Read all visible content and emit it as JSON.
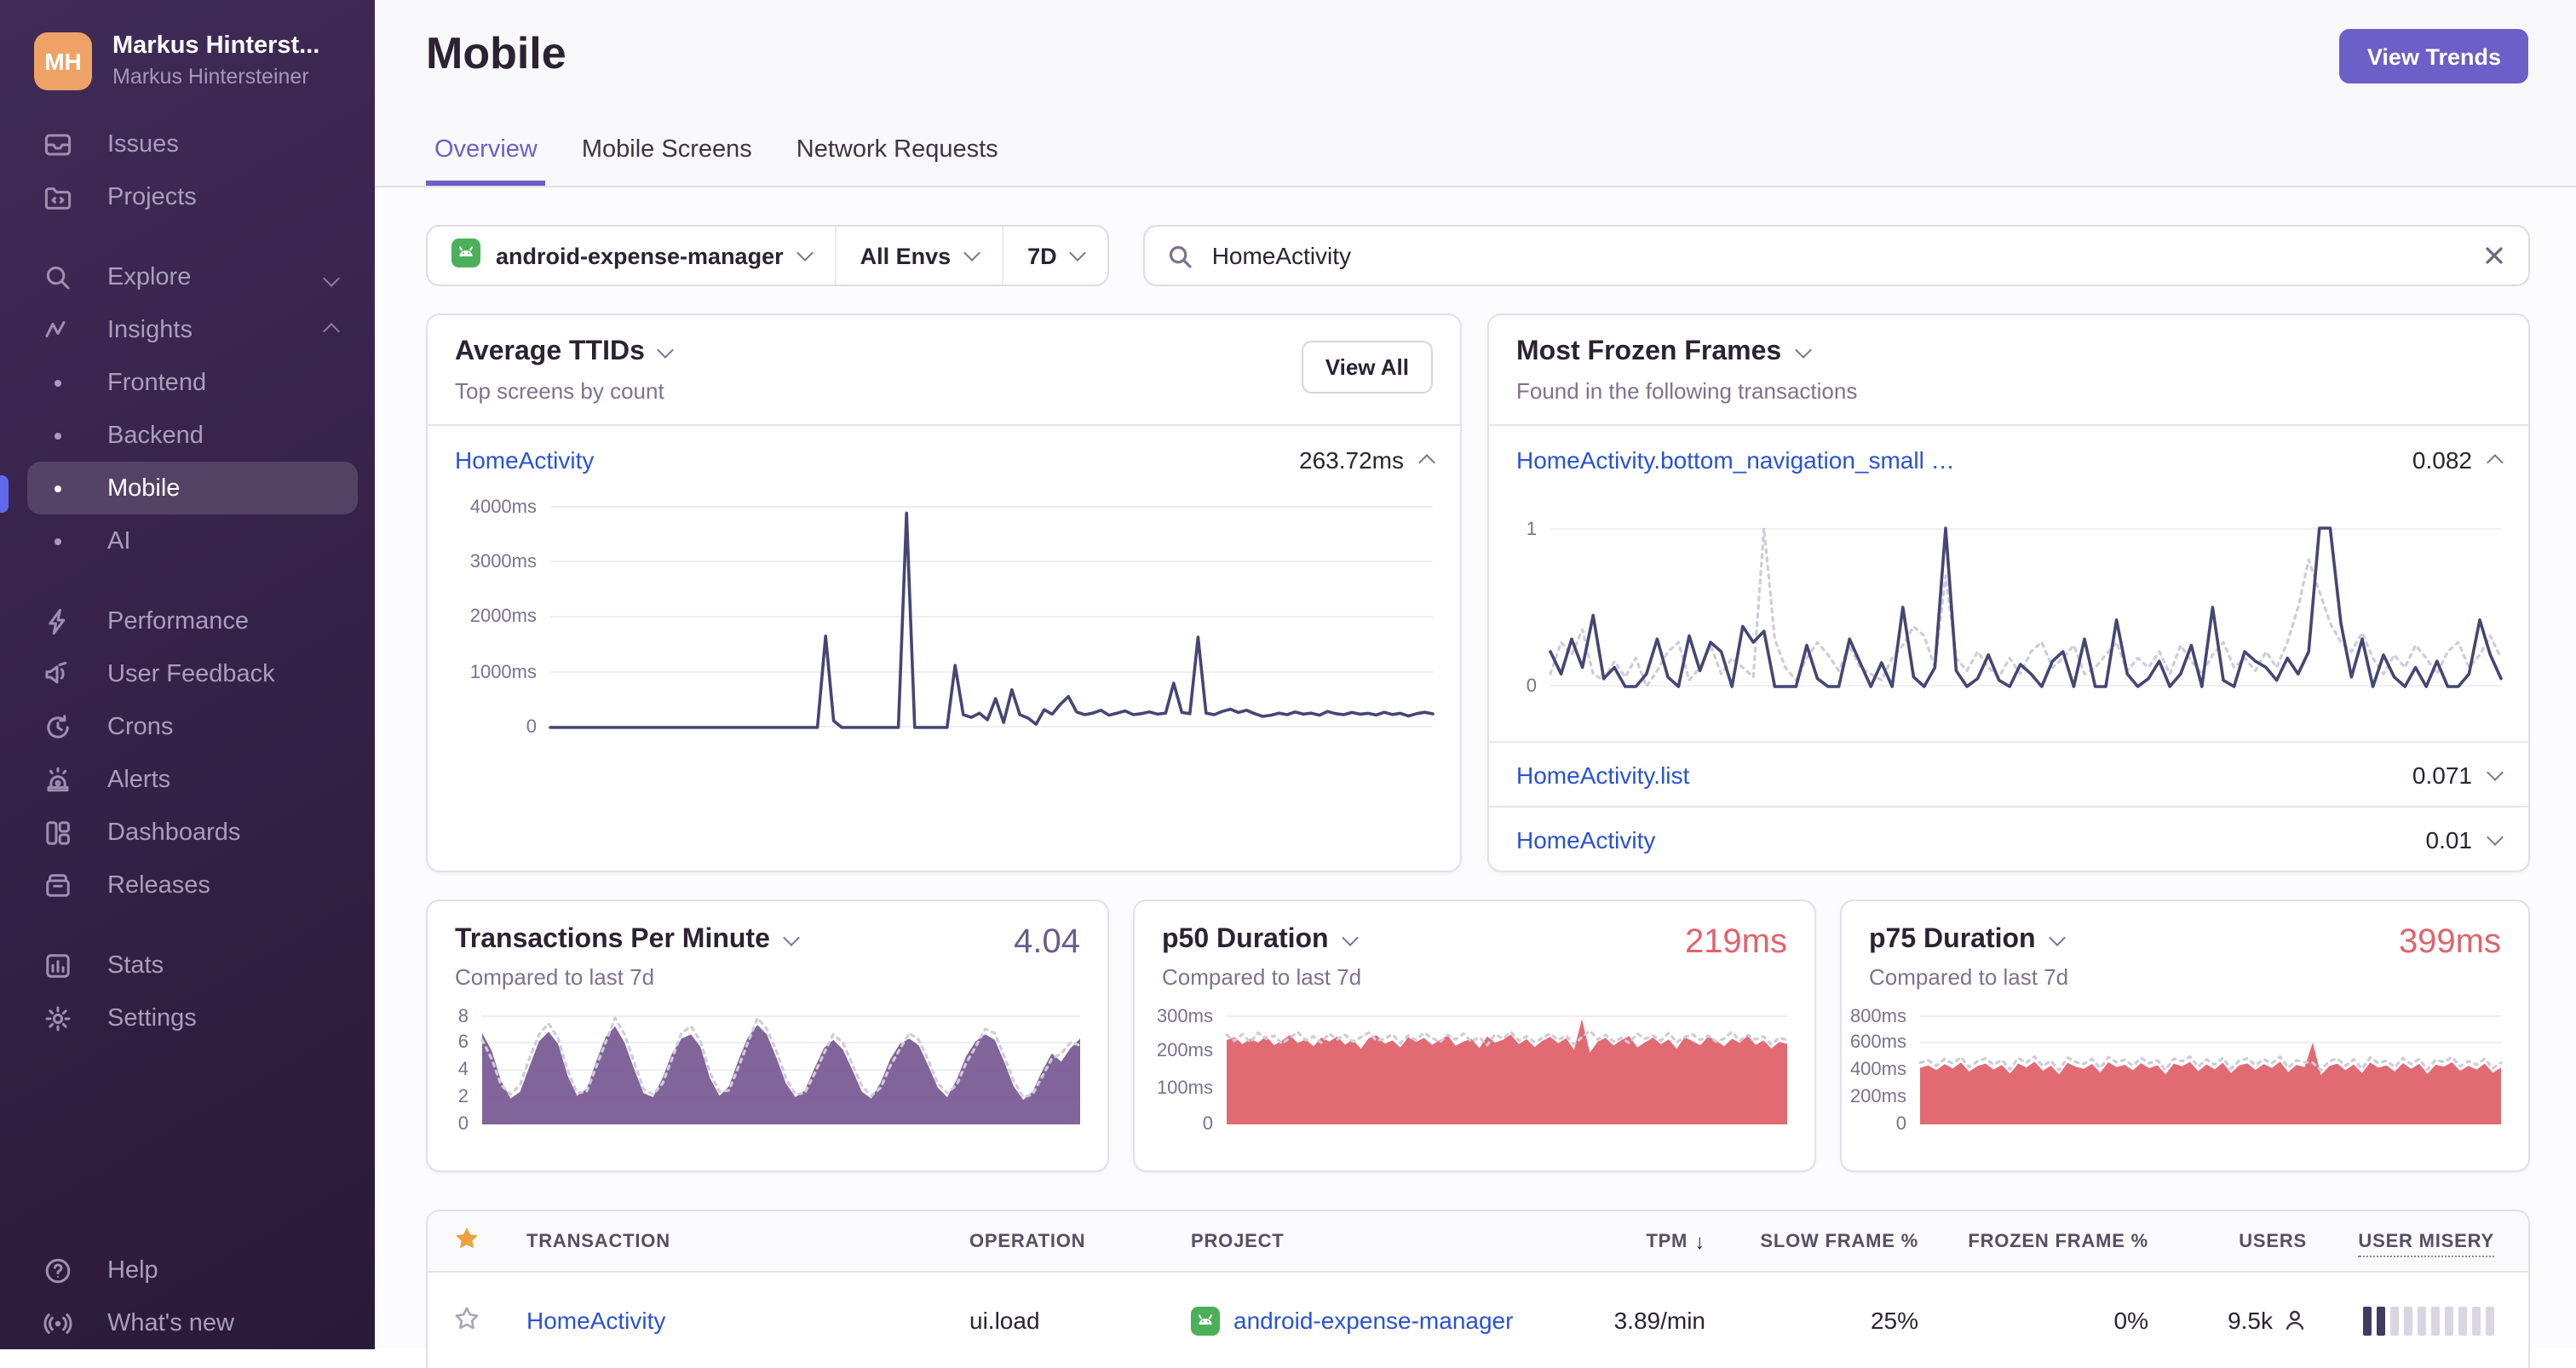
{
  "sidebar": {
    "user_initials": "MH",
    "user_name": "Markus Hinterst...",
    "user_org": "Markus Hintersteiner",
    "issues": "Issues",
    "projects": "Projects",
    "explore": "Explore",
    "insights": "Insights",
    "frontend": "Frontend",
    "backend": "Backend",
    "mobile": "Mobile",
    "ai": "AI",
    "performance": "Performance",
    "user_feedback": "User Feedback",
    "crons": "Crons",
    "alerts": "Alerts",
    "dashboards": "Dashboards",
    "releases": "Releases",
    "stats": "Stats",
    "settings": "Settings",
    "help": "Help",
    "whats_new": "What's new"
  },
  "header": {
    "title": "Mobile",
    "view_trends": "View Trends",
    "tabs": [
      {
        "label": "Overview",
        "active": true
      },
      {
        "label": "Mobile Screens",
        "active": false
      },
      {
        "label": "Network Requests",
        "active": false
      }
    ]
  },
  "filters": {
    "project": "android-expense-manager",
    "environment": "All Envs",
    "period": "7D"
  },
  "search": {
    "value": "HomeActivity"
  },
  "cards": {
    "ttid": {
      "title": "Average TTIDs",
      "subtitle": "Top screens by count",
      "action": "View All",
      "row_name": "HomeActivity",
      "row_value": "263.72ms"
    },
    "frozen": {
      "title": "Most Frozen Frames",
      "subtitle": "Found in the following transactions",
      "row1_name": "HomeActivity.bottom_navigation_small …",
      "row1_value": "0.082",
      "row2_name": "HomeActivity.list",
      "row2_value": "0.071",
      "row3_name": "HomeActivity",
      "row3_value": "0.01"
    },
    "tpm": {
      "title": "Transactions Per Minute",
      "subtitle": "Compared to last 7d",
      "value": "4.04"
    },
    "p50": {
      "title": "p50 Duration",
      "subtitle": "Compared to last 7d",
      "value": "219ms"
    },
    "p75": {
      "title": "p75 Duration",
      "subtitle": "Compared to last 7d",
      "value": "399ms"
    }
  },
  "table": {
    "columns": {
      "transaction": "TRANSACTION",
      "operation": "OPERATION",
      "project": "PROJECT",
      "tpm": "TPM",
      "slow": "SLOW FRAME %",
      "frozen": "FROZEN FRAME %",
      "users": "USERS",
      "misery": "USER MISERY"
    },
    "row": {
      "transaction": "HomeActivity",
      "operation": "ui.load",
      "project": "android-expense-manager",
      "tpm": "3.89/min",
      "slow": "25%",
      "frozen": "0%",
      "users": "9.5k",
      "misery_filled": 2,
      "misery_total": 10
    }
  },
  "colors": {
    "accent_purple": "#6C5FC7",
    "link_blue": "#2952D9",
    "chart_line": "#444674",
    "chart_dotted": "#CFCBDA",
    "tpm_fill": "#7A5C95",
    "duration_fill": "#E0636C",
    "star_gold": "#EBA23E",
    "android_green": "#4CB05A"
  },
  "chart_data": [
    {
      "id": "ttid",
      "type": "line",
      "name": "Average TTID over time (HomeActivity)",
      "ylabel": "ms",
      "ylim": [
        0,
        4000
      ],
      "grid": true,
      "legend": "none",
      "ticks": [
        {
          "v": 4000,
          "label": "4000ms"
        },
        {
          "v": 3000,
          "label": "3000ms"
        },
        {
          "v": 2000,
          "label": "2000ms"
        },
        {
          "v": 1000,
          "label": "1000ms"
        },
        {
          "v": 0,
          "label": "0"
        }
      ],
      "series": [
        {
          "name": "ttid",
          "style": "solid",
          "color": "#444674",
          "values": [
            0,
            0,
            0,
            0,
            0,
            0,
            0,
            0,
            0,
            0,
            0,
            0,
            0,
            0,
            0,
            0,
            0,
            0,
            0,
            0,
            0,
            0,
            0,
            0,
            0,
            0,
            0,
            0,
            0,
            0,
            0,
            0,
            0,
            0,
            1650,
            120,
            0,
            0,
            0,
            0,
            0,
            0,
            0,
            0,
            3870,
            0,
            0,
            0,
            0,
            0,
            1120,
            230,
            180,
            260,
            140,
            520,
            90,
            680,
            230,
            170,
            60,
            320,
            240,
            420,
            560,
            280,
            230,
            260,
            310,
            220,
            260,
            300,
            230,
            250,
            280,
            240,
            260,
            800,
            270,
            250,
            1630,
            260,
            230,
            290,
            330,
            270,
            310,
            250,
            200,
            220,
            260,
            230,
            280,
            240,
            260,
            220,
            290,
            250,
            230,
            270,
            240,
            255,
            225,
            275,
            235,
            255,
            205,
            250,
            275,
            245
          ]
        }
      ]
    },
    {
      "id": "frozen",
      "type": "line",
      "name": "Frozen frames rate (HomeActivity.bottom_navigation_small)",
      "ylim": [
        0,
        1
      ],
      "grid": true,
      "legend": "none",
      "ticks": [
        {
          "v": 1,
          "label": "1"
        },
        {
          "v": 0,
          "label": "0"
        }
      ],
      "series": [
        {
          "name": "previous period",
          "style": "dotted",
          "color": "#CFCBDA",
          "values": [
            0.08,
            0.28,
            0.2,
            0.36,
            0.08,
            0.04,
            0.16,
            0.06,
            0.18,
            0,
            0.1,
            0.22,
            0.28,
            0.04,
            0.12,
            0.26,
            0.08,
            0.18,
            0.12,
            0.06,
            1,
            0.3,
            0.12,
            0.04,
            0.18,
            0.28,
            0.2,
            0.1,
            0.26,
            0.12,
            0.08,
            0.04,
            0.18,
            0.26,
            0.38,
            0.32,
            0.12,
            0.7,
            0.18,
            0.1,
            0.22,
            0.12,
            0.06,
            0.18,
            0.08,
            0.22,
            0.28,
            0.12,
            0.18,
            0.26,
            0.08,
            0.12,
            0.2,
            0.28,
            0.1,
            0.18,
            0.12,
            0.22,
            0.08,
            0.26,
            0.16,
            0.08,
            0.2,
            0.28,
            0.12,
            0.18,
            0.1,
            0.22,
            0.12,
            0.28,
            0.5,
            0.8,
            0.6,
            0.4,
            0.28,
            0.22,
            0.34,
            0.18,
            0.08,
            0.2,
            0.12,
            0.26,
            0.18,
            0.08,
            0.22,
            0.28,
            0.12,
            0.2,
            0.32,
            0.18
          ]
        },
        {
          "name": "current period",
          "style": "solid",
          "color": "#444674",
          "values": [
            0.22,
            0.08,
            0.3,
            0.12,
            0.45,
            0.05,
            0.12,
            0,
            0,
            0.08,
            0.3,
            0.06,
            0,
            0.32,
            0.1,
            0.28,
            0.22,
            0,
            0.38,
            0.28,
            0.35,
            0,
            0,
            0,
            0.26,
            0.05,
            0,
            0,
            0.3,
            0.15,
            0,
            0.15,
            0,
            0.5,
            0.06,
            0,
            0.12,
            1,
            0.1,
            0,
            0.05,
            0.2,
            0.04,
            0,
            0.14,
            0.08,
            0,
            0.16,
            0.22,
            0,
            0.3,
            0,
            0,
            0.42,
            0.08,
            0,
            0.05,
            0.16,
            0,
            0.08,
            0.26,
            0,
            0.5,
            0.04,
            0,
            0.22,
            0.16,
            0.12,
            0.04,
            0.18,
            0.08,
            0.22,
            1,
            1,
            0.4,
            0.06,
            0.3,
            0,
            0.2,
            0.06,
            0,
            0.12,
            0,
            0.16,
            0,
            0,
            0.08,
            0.42,
            0.2,
            0.05
          ]
        }
      ]
    },
    {
      "id": "tpm",
      "type": "area",
      "name": "Transactions Per Minute vs last 7d",
      "ylim": [
        0,
        8
      ],
      "grid": true,
      "legend": "none",
      "ticks": [
        {
          "v": 8,
          "label": "8"
        },
        {
          "v": 6,
          "label": "6"
        },
        {
          "v": 4,
          "label": "4"
        },
        {
          "v": 2,
          "label": "2"
        },
        {
          "v": 0,
          "label": "0"
        }
      ],
      "series": [
        {
          "name": "current period",
          "style": "area",
          "color": "#7A5C95",
          "values": [
            6.7,
            5.4,
            3.2,
            1.9,
            2.4,
            4.3,
            6.1,
            6.8,
            5.9,
            3.6,
            2.1,
            2.6,
            4.6,
            6.4,
            7.2,
            6.0,
            4.1,
            2.3,
            2.0,
            3.4,
            5.2,
            6.3,
            6.6,
            5.7,
            3.4,
            2.1,
            2.8,
            4.7,
            6.4,
            7.3,
            6.6,
            4.9,
            3.0,
            2.0,
            2.5,
            4.1,
            5.6,
            6.2,
            5.5,
            4.0,
            2.4,
            1.9,
            3.1,
            4.8,
            5.9,
            6.3,
            5.8,
            4.3,
            2.7,
            2.0,
            3.3,
            5.0,
            6.1,
            6.6,
            6.2,
            4.6,
            2.8,
            1.8,
            2.4,
            3.9,
            5.2,
            4.6,
            5.6,
            6.3
          ]
        },
        {
          "name": "previous period",
          "style": "dotted",
          "color": "#CFCBDA",
          "values": [
            6.2,
            4.8,
            2.9,
            2.2,
            2.9,
            4.9,
            6.6,
            7.4,
            6.3,
            4.0,
            2.3,
            2.4,
            4.2,
            6.0,
            7.8,
            6.6,
            4.6,
            2.6,
            2.2,
            3.0,
            4.8,
            6.7,
            7.2,
            6.1,
            3.8,
            2.4,
            2.5,
            4.2,
            6.0,
            7.8,
            7.0,
            5.4,
            3.4,
            2.2,
            2.3,
            3.7,
            5.2,
            6.6,
            6.0,
            4.4,
            2.8,
            2.1,
            2.7,
            4.3,
            5.5,
            6.7,
            6.2,
            4.7,
            3.0,
            2.3,
            2.9,
            4.5,
            5.7,
            7.0,
            6.7,
            5.0,
            3.2,
            2.0,
            2.2,
            3.5,
            4.8,
            5.2,
            6.0,
            5.8
          ]
        }
      ]
    },
    {
      "id": "p50",
      "type": "area",
      "name": "p50 Duration vs last 7d",
      "ylim": [
        0,
        300
      ],
      "grid": true,
      "legend": "none",
      "ticks": [
        {
          "v": 300,
          "label": "300ms"
        },
        {
          "v": 200,
          "label": "200ms"
        },
        {
          "v": 100,
          "label": "100ms"
        },
        {
          "v": 0,
          "label": "0"
        }
      ],
      "series": [
        {
          "name": "current period",
          "style": "area",
          "color": "#E0636C",
          "values": [
            232,
            240,
            221,
            236,
            225,
            243,
            218,
            230,
            246,
            224,
            234,
            215,
            239,
            228,
            242,
            220,
            233,
            208,
            237,
            245,
            222,
            231,
            212,
            240,
            227,
            238,
            219,
            232,
            244,
            216,
            228,
            236,
            210,
            242,
            225,
            233,
            247,
            221,
            235,
            213,
            230,
            241,
            223,
            237,
            205,
            290,
            198,
            228,
            238,
            217,
            232,
            243,
            212,
            226,
            239,
            221,
            234,
            208,
            240,
            229,
            218,
            242,
            230,
            215,
            236,
            224,
            244,
            219,
            231,
            209,
            227,
            222
          ]
        },
        {
          "name": "previous period",
          "style": "dotted",
          "color": "#CFCBDA",
          "values": [
            246,
            230,
            248,
            226,
            252,
            236,
            244,
            222,
            238,
            254,
            232,
            242,
            225,
            250,
            234,
            246,
            228,
            240,
            252,
            230,
            236,
            248,
            224,
            244,
            232,
            252,
            238,
            226,
            246,
            234,
            250,
            228,
            240,
            218,
            248,
            236,
            254,
            230,
            242,
            226,
            238,
            250,
            232,
            244,
            220,
            240,
            258,
            234,
            246,
            228,
            238,
            224,
            250,
            236,
            244,
            230,
            252,
            226,
            240,
            248,
            232,
            244,
            228,
            236,
            254,
            230,
            246,
            234,
            242,
            220,
            238,
            232
          ]
        }
      ]
    },
    {
      "id": "p75",
      "type": "area",
      "name": "p75 Duration vs last 7d",
      "ylim": [
        0,
        800
      ],
      "grid": true,
      "legend": "none",
      "ticks": [
        {
          "v": 800,
          "label": "800ms"
        },
        {
          "v": 600,
          "label": "600ms"
        },
        {
          "v": 400,
          "label": "400ms"
        },
        {
          "v": 200,
          "label": "200ms"
        },
        {
          "v": 0,
          "label": "0"
        }
      ],
      "series": [
        {
          "name": "current period",
          "style": "area",
          "color": "#E0636C",
          "values": [
            415,
            432,
            398,
            442,
            410,
            455,
            388,
            428,
            446,
            402,
            436,
            372,
            448,
            418,
            460,
            394,
            430,
            366,
            452,
            424,
            408,
            444,
            380,
            456,
            420,
            438,
            396,
            450,
            412,
            434,
            368,
            446,
            426,
            458,
            390,
            440,
            404,
            452,
            376,
            432,
            448,
            400,
            442,
            414,
            460,
            384,
            436,
            420,
            600,
            362,
            428,
            446,
            398,
            440,
            376,
            454,
            416,
            432,
            388,
            450,
            408,
            444,
            370,
            438,
            424,
            456,
            392,
            430,
            402,
            446,
            380,
            418
          ]
        },
        {
          "name": "previous period",
          "style": "dotted",
          "color": "#CFCBDA",
          "values": [
            452,
            470,
            430,
            480,
            446,
            492,
            420,
            462,
            484,
            438,
            472,
            404,
            486,
            452,
            498,
            428,
            466,
            398,
            490,
            458,
            442,
            480,
            412,
            494,
            456,
            474,
            430,
            488,
            448,
            470,
            400,
            482,
            462,
            496,
            424,
            476,
            438,
            488,
            408,
            468,
            484,
            434,
            478,
            448,
            496,
            416,
            470,
            456,
            452,
            398,
            464,
            482,
            430,
            476,
            408,
            490,
            450,
            468,
            420,
            486,
            442,
            480,
            402,
            474,
            458,
            492,
            426,
            464,
            436,
            482,
            412,
            452
          ]
        }
      ]
    }
  ]
}
